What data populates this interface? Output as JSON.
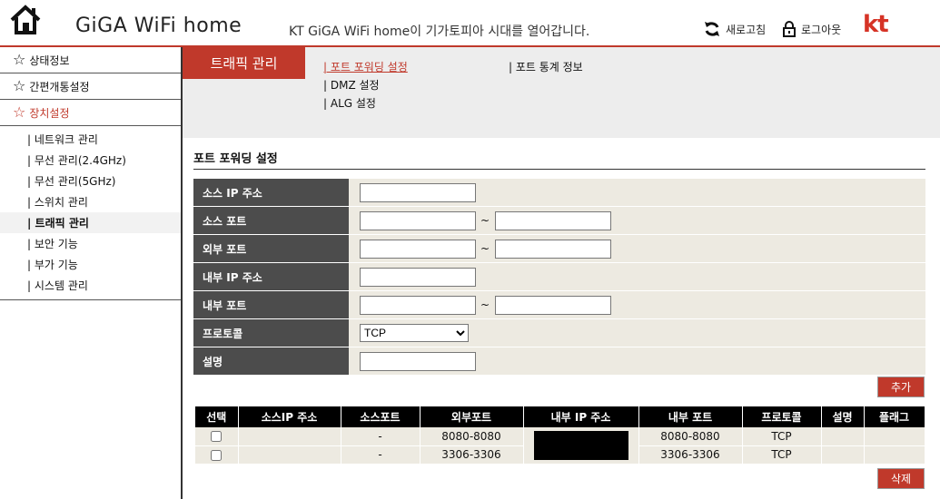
{
  "header": {
    "title": "GiGA WiFi home",
    "tagline": "KT GiGA WiFi home이 기가토피아 시대를 열어갑니다.",
    "refresh_label": "새로고침",
    "logout_label": "로그아웃",
    "logo_text": "kt",
    "accent_color": "#c0392b"
  },
  "sidebar": {
    "top_items": [
      {
        "label": "상태정보"
      },
      {
        "label": "간편개통설정"
      },
      {
        "label": "장치설정"
      }
    ],
    "sub_items": [
      {
        "label": "| 네트워크 관리"
      },
      {
        "label": "| 무선 관리(2.4GHz)"
      },
      {
        "label": "| 무선 관리(5GHz)"
      },
      {
        "label": "| 스위치 관리"
      },
      {
        "label": "| 트래픽 관리"
      },
      {
        "label": "| 보안 기능"
      },
      {
        "label": "| 부가 기능"
      },
      {
        "label": "| 시스템 관리"
      }
    ]
  },
  "subnav": {
    "section_title": "트래픽 관리",
    "links": [
      {
        "label": "| 포트 포워딩 설정"
      },
      {
        "label": "| DMZ 설정"
      },
      {
        "label": "| ALG 설정"
      },
      {
        "label": "| 포트 통계 정보"
      }
    ]
  },
  "form": {
    "title": "포트 포워딩 설정",
    "fields": {
      "source_ip": {
        "label": "소스 IP 주소",
        "value": ""
      },
      "source_port": {
        "label": "소스 포트",
        "from": "",
        "to": ""
      },
      "external_port": {
        "label": "외부 포트",
        "from": "",
        "to": ""
      },
      "internal_ip": {
        "label": "내부 IP 주소",
        "value": ""
      },
      "internal_port": {
        "label": "내부 포트",
        "from": "",
        "to": ""
      },
      "protocol": {
        "label": "프로토콜",
        "value": "TCP"
      },
      "description": {
        "label": "설명",
        "value": ""
      }
    },
    "tilde": "~",
    "add_label": "추가",
    "delete_label": "삭제"
  },
  "table": {
    "headers": [
      "선택",
      "소스IP 주소",
      "소스포트",
      "외부포트",
      "내부 IP 주소",
      "내부 포트",
      "프로토콜",
      "설명",
      "플래그"
    ],
    "rows": [
      {
        "source_ip": "",
        "source_port": "-",
        "external_port": "8080-8080",
        "internal_port": "8080-8080",
        "protocol": "TCP",
        "description": "",
        "flag": ""
      },
      {
        "source_ip": "",
        "source_port": "-",
        "external_port": "3306-3306",
        "internal_port": "3306-3306",
        "protocol": "TCP",
        "description": "",
        "flag": ""
      }
    ]
  },
  "icons": {
    "home": "home-icon",
    "refresh": "refresh-icon",
    "logout": "lock-icon",
    "star": "star-icon"
  }
}
